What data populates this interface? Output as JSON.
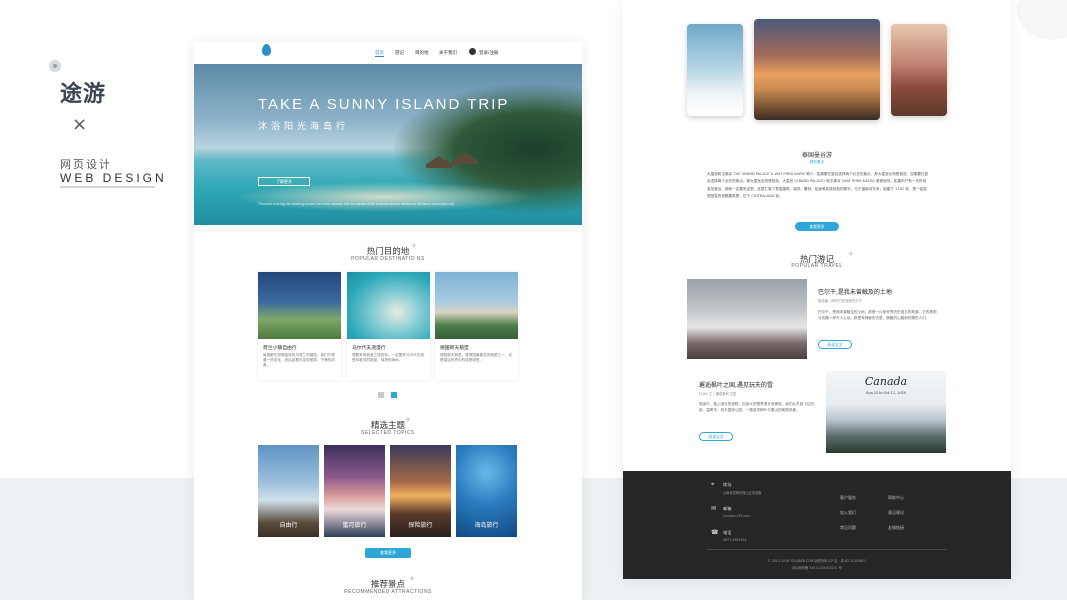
{
  "intro": {
    "title": "途游",
    "close": "×",
    "subtitle": "网页设计",
    "english": "WEB DESIGN"
  },
  "nav": {
    "items": [
      "首页",
      "游记",
      "目的地",
      "关于我们"
    ],
    "login": "登录/注册"
  },
  "hero": {
    "title": "TAKE A SUNNY ISLAND TRIP",
    "subtitle": "沐浴阳光海岛行",
    "button": "了解更多",
    "note": "The world is so big, we should go to see, live in the moment, feel the warmth of the sunshine and the freedom of the island, and enjoy a trip."
  },
  "popular": {
    "title": "热门目的地",
    "subtitle": "POPULAR DESTINATIO NS",
    "cards": [
      {
        "title": "荷兰小镇自由行",
        "desc": "每周都在感受独特的与荷兰的邂逅，我们只想要一些变化，然后走着去发现美丽，宁静的风景。"
      },
      {
        "title": "马尔代夫浪漫行",
        "desc": "想要来场浪漫之旅的你，一定要来马尔代夫感受印度洋的蔚蓝，纯净的海水。"
      },
      {
        "title": "德国新天鹅堡",
        "desc": "德国新天鹅堡，是德国最著名的城堡之一，也是童话世界中的城堡原型。"
      }
    ]
  },
  "topics": {
    "title": "精选主题",
    "subtitle": "SELECTED TOPICS",
    "items": [
      "自由行",
      "蜜月旅行",
      "探险旅行",
      "海岛旅行"
    ],
    "more": "查看更多"
  },
  "recommended": {
    "title": "推荐景点",
    "subtitle": "RECOMMENDED ATTRACTIONS"
  },
  "temple": {
    "title": "泰国曼谷游",
    "subtitle": "精彩看点",
    "para": "大皇宫和玉佛寺 THE GRAND PALACE & WAT PHRA KAEW 简介：如果要在曼谷选择两个必去的景点，那大皇宫必然是首选，如果要在曼谷选择两个必去的景点，那大皇宫必然是首选，大皇宫 (GRAND PALACE) 和玉佛寺 (WAT PHRA KAEW) 紧紧相邻，如果你只有一天时间游览曼谷，那就一定要来这里，这里汇集了泰国建筑、装饰、雕刻、绘画等民族特色的精华，位于湄南河东岸，始建于 1782 年，是一组富丽堂皇的宫殿建筑群，位于 CHITRALADA 宫。",
    "more": "查看更多"
  },
  "hot": {
    "title": "热门游记",
    "subtitle": "POPULAR TRAVEL",
    "articles": [
      {
        "title": "巴尔干,是我未曾触及的土地",
        "meta": "旅游者 / 阿尔巴尼亚和巴尔干",
        "text": "巴尔干，是我未曾触及的土地，那是一片被世界历史遗忘的角落，它的美丽与伤痛一样令人心动。那里有神秘的古堡，蜿蜒的山路和热情的人们。",
        "button": "阅读全文"
      },
      {
        "title": "邂逅枫叶之国,遇见玩夫的雪",
        "meta": "FLAG 之 | 邂逅枫叶之国",
        "text": "旅途中，踏上漫长的旅程，加拿大的雪季漫长而美丽，我们从东部飞往西部，温哥华、班夫国家公园，一路追寻枫叶与雪山的美丽风景。",
        "button": "阅读全文"
      }
    ],
    "canada_script": "Canada",
    "canada_date": "Sep.25 to Oct.12, 2018"
  },
  "footer": {
    "address_label": "地址",
    "address": "云南省昆明市西山区滇池路",
    "email_label": "邮箱",
    "email": "youjiaer.163.com",
    "phone_label": "电话",
    "phone": "0871-3987634",
    "col1": [
      "客户服务",
      "加入我们",
      "常见问题"
    ],
    "col2": [
      "帮助中心",
      "意见建议",
      "友情链接"
    ],
    "copyright": "© 2014-2018 YOUJIAER.COM 版权所有 ICP 证：滇 B2-20104601",
    "record": "滇公网安备 53011102000231 号"
  },
  "colors": {
    "accent": "#2ea6d8",
    "footer": "#262626"
  }
}
